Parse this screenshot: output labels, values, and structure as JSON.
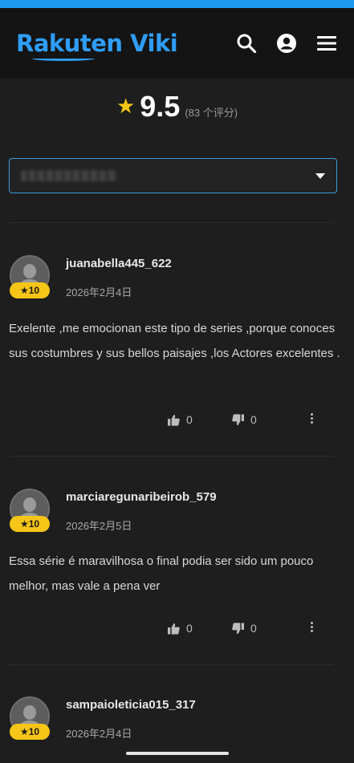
{
  "header": {
    "logo_text": "Rakuten Viki",
    "icons": [
      "search-icon",
      "account-icon",
      "menu-icon"
    ],
    "brand_color": "#2f9df7"
  },
  "rating": {
    "value": "9.5",
    "count_text": "(83 个评分)",
    "star_color": "#f5c518"
  },
  "reviews": [
    {
      "username": "juanabella445_622",
      "date": "2026年2月4日",
      "score": "★10",
      "text": "Exelente ,me emocionan este tipo de series ,porque conoces sus costumbres y sus bellos paisajes ,los Actores excelentes .",
      "likes": "0",
      "dislikes": "0"
    },
    {
      "username": "marciaregunaribeirob_579",
      "date": "2026年2月5日",
      "score": "★10",
      "text": "Essa série é maravilhosa o final podia ser sido um pouco melhor, mas vale a pena ver",
      "likes": "0",
      "dislikes": "0"
    },
    {
      "username": "sampaioleticia015_317",
      "date": "2026年2月4日",
      "score": "★10"
    }
  ]
}
